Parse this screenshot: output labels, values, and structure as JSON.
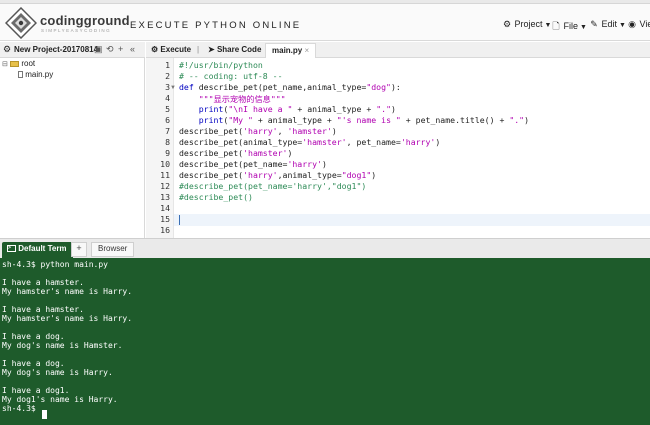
{
  "header": {
    "brand": "codingground",
    "brand_sub": "SIMPLYEASYCODING",
    "title": "EXECUTE PYTHON ONLINE",
    "menu": {
      "project": "Project",
      "file": "File",
      "edit": "Edit",
      "view": "View"
    }
  },
  "project": {
    "title": "New Project-20170814",
    "tree_root": "root",
    "tree_file": "main.py"
  },
  "editor": {
    "tab_execute": "Execute",
    "tab_sep": "|",
    "tab_share": "Share Code",
    "tab_file": "main.py",
    "tab_close": "×",
    "line_numbers": [
      "1",
      "2",
      "3",
      "4",
      "5",
      "6",
      "7",
      "8",
      "9",
      "10",
      "11",
      "12",
      "13",
      "14",
      "15",
      "16"
    ],
    "code": {
      "l1": "#!/usr/bin/python",
      "l2": "# -- coding: utf-8 --",
      "l3_kw": "def",
      "l3_a": " describe_pet(pet_name,animal_type=",
      "l3_s": "\"dog\"",
      "l3_b": "):",
      "l4": "    \"\"\"显示宠物的信息\"\"\"",
      "l5_kw": "    print",
      "l5_a": "(",
      "l5_s1": "\"\\nI have a \"",
      "l5_b": " + animal_type + ",
      "l5_s2": "\".\"",
      "l5_c": ")",
      "l6_kw": "    print",
      "l6_a": "(",
      "l6_s1": "\"My \"",
      "l6_b": " + animal_type + ",
      "l6_s2": "\"'s name is \"",
      "l6_c": " + pet_name.title() + ",
      "l6_s3": "\".\"",
      "l6_d": ")",
      "l7_a": "describe_pet(",
      "l7_s1": "'harry'",
      "l7_b": ", ",
      "l7_s2": "'hamster'",
      "l7_c": ")",
      "l8_a": "describe_pet(animal_type=",
      "l8_s1": "'hamster'",
      "l8_b": ", pet_name=",
      "l8_s2": "'harry'",
      "l8_c": ")",
      "l9_a": "describe_pet(",
      "l9_s1": "'hamster'",
      "l9_c": ")",
      "l10_a": "describe_pet(pet_name=",
      "l10_s1": "'harry'",
      "l10_c": ")",
      "l11_a": "describe_pet(",
      "l11_s1": "'harry'",
      "l11_b": ",animal_type=",
      "l11_s2": "\"dog1\"",
      "l11_c": ")",
      "l12": "#describe_pet(pet_name='harry',\"dog1\")",
      "l13": "#describe_pet()"
    }
  },
  "terminal": {
    "tab_term": "Default Term",
    "tab_add": "+",
    "tab_browser": "Browser",
    "lines": [
      "sh-4.3$ python main.py",
      "",
      "I have a hamster.",
      "My hamster's name is Harry.",
      "",
      "I have a hamster.",
      "My hamster's name is Harry.",
      "",
      "I have a dog.",
      "My dog's name is Hamster.",
      "",
      "I have a dog.",
      "My dog's name is Harry.",
      "",
      "I have a dog1.",
      "My dog1's name is Harry.",
      "sh-4.3$ "
    ]
  },
  "colors": {
    "terminal_bg": "#1e5b2b",
    "keyword": "#0000c0",
    "string": "#b000b0",
    "comment": "#2e8b57"
  },
  "icons": {
    "logo": "coding-ground-logo",
    "project": "gear-icon",
    "file": "file-icon",
    "edit": "edit-icon",
    "view": "eye-icon",
    "execute": "gear-icon",
    "share": "share-icon",
    "terminal": "terminal-icon"
  }
}
